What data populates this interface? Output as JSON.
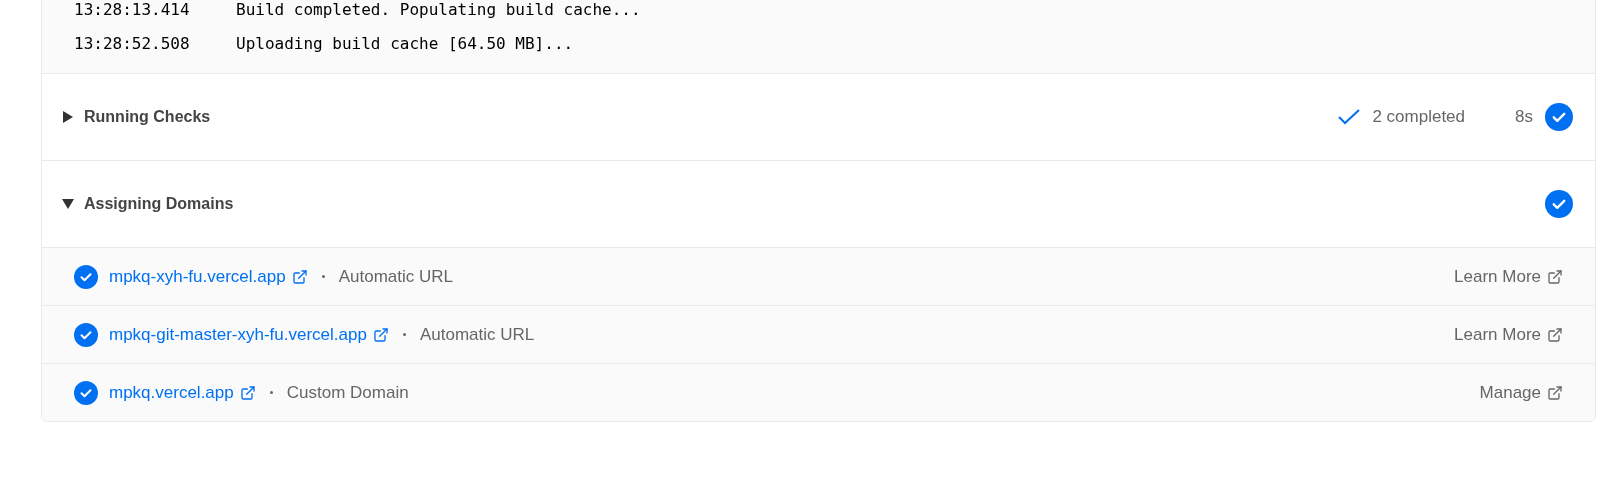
{
  "log": [
    {
      "time": "13:28:13.414",
      "message": "Build completed. Populating build cache..."
    },
    {
      "time": "13:28:52.508",
      "message": "Uploading build cache [64.50 MB]..."
    }
  ],
  "sections": [
    {
      "title": "Running Checks",
      "expanded": false,
      "summary": "2 completed",
      "duration": "8s",
      "done": true
    },
    {
      "title": "Assigning Domains",
      "expanded": true,
      "done": true,
      "domains": [
        {
          "url": "mpkq-xyh-fu.vercel.app",
          "type": "Automatic URL",
          "action": "Learn More",
          "done": true
        },
        {
          "url": "mpkq-git-master-xyh-fu.vercel.app",
          "type": "Automatic URL",
          "action": "Learn More",
          "done": true
        },
        {
          "url": "mpkq.vercel.app",
          "type": "Custom Domain",
          "action": "Manage",
          "done": true
        }
      ]
    }
  ]
}
